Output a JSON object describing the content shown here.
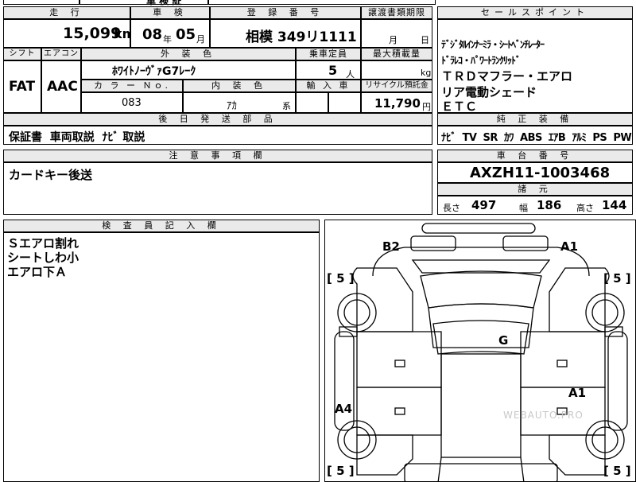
{
  "top_strip": {
    "partial_text": "車 検 証"
  },
  "mileage": {
    "header": "走 行",
    "value": "15,099",
    "unit": "km"
  },
  "shaken": {
    "header": "車 検",
    "year": "08",
    "year_unit": "年",
    "month": "05",
    "month_unit": "月"
  },
  "registration": {
    "header": "登 録 番 号",
    "value": "相模 349リ1111"
  },
  "transfer": {
    "header": "譲渡書類期限",
    "month_unit": "月",
    "day_unit": "日"
  },
  "sales_points": {
    "header": "セールスポイント",
    "items": [
      "ﾃﾞｼﾞﾀﾙｲﾝﾅｰﾐﾗ・ｼｰﾄﾍﾞﾝﾁﾚｰﾀｰ",
      "ﾄﾞﾗﾚｺ・ﾊﾟﾜｰﾄﾗﾝｸﾘｯﾄﾞ",
      "ＴＲＤマフラー・エアロ",
      "リア電動シェード",
      "ＥＴＣ"
    ]
  },
  "shift": {
    "header": "シフト",
    "value": "FAT"
  },
  "aircon": {
    "header": "エアコン",
    "value": "AAC"
  },
  "exterior": {
    "header": "外 装 色",
    "value": "ﾎﾜｲﾄﾉｰｳﾞｧG7ﾚｰｸ"
  },
  "capacity": {
    "header": "乗車定員",
    "value": "5",
    "unit": "人"
  },
  "max_load": {
    "header": "最大積載量",
    "unit": "kg"
  },
  "color_no": {
    "header": "カ ラ ー Ｎｏ.",
    "value": "083"
  },
  "interior": {
    "header": "内 装 色",
    "value": "ｱｶ",
    "suffix": "系"
  },
  "import_car": {
    "header": "輸 入 車"
  },
  "recycle": {
    "header": "リサイクル預託金",
    "value": "11,790",
    "unit": "円"
  },
  "later_items": {
    "header": "後 日 発 送 部 品",
    "value": "保証書  車両取説  ﾅﾋﾞ 取説"
  },
  "equipment": {
    "header": "純 正 装 備",
    "value": "ﾅﾋﾞ  TV  SR  ｶﾜ  ABS  ｴｱB  ｱﾙﾐ  PS  PW"
  },
  "notes": {
    "header": "注 意 事 項 欄",
    "value": "カードキー後送"
  },
  "chassis": {
    "header": "車 台 番 号",
    "value": "AXZH11-1003468"
  },
  "specs": {
    "header": "諸 元",
    "length_label": "長さ",
    "length": "497",
    "width_label": "幅",
    "width": "186",
    "height_label": "高さ",
    "height": "144"
  },
  "inspector": {
    "header": "検 査 員 記 入 欄",
    "lines": [
      "Ｓエアロ割れ",
      "シートしわ小",
      "エアロ下Ａ"
    ]
  },
  "diagram": {
    "marks": [
      "B2",
      "A1",
      "G",
      "A1",
      "A4"
    ],
    "tire_labels": [
      "[ 5 ]",
      "[ 5 ]",
      "[ 5 ]",
      "[ 5 ]"
    ],
    "watermark": "WEBAUTO.PRO"
  }
}
